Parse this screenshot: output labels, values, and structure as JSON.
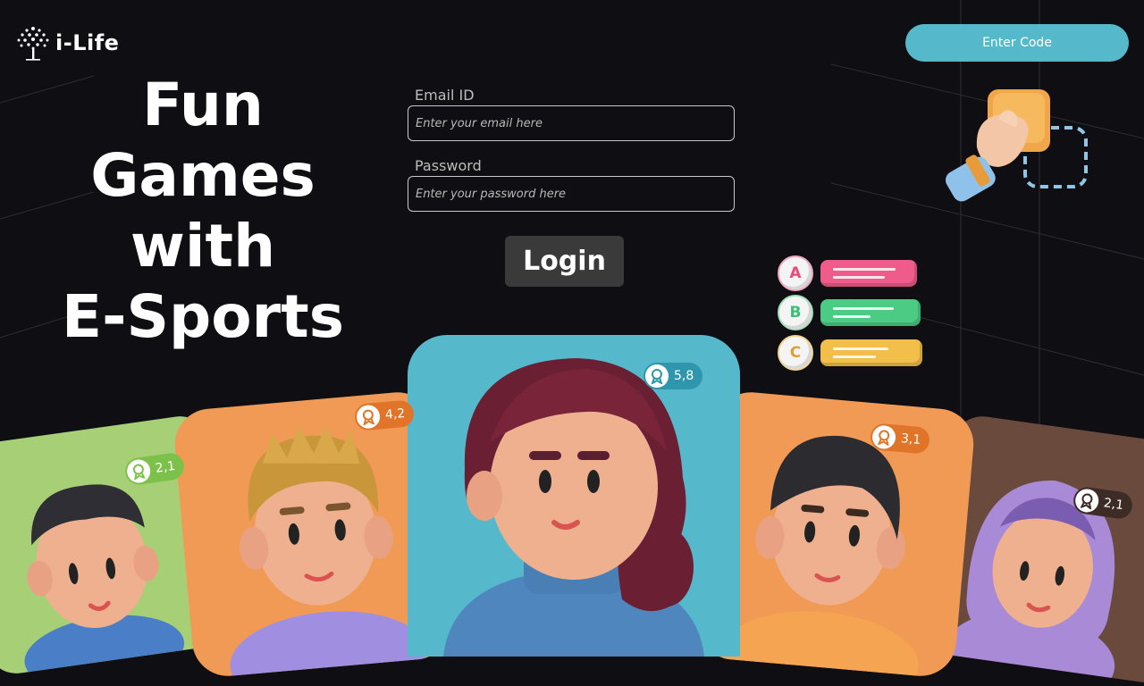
{
  "brand": {
    "name": "i-Life"
  },
  "headline": {
    "line1": "Fun",
    "line2": "Games",
    "line3": "with",
    "line4": "E-Sports"
  },
  "enter_code_label": "Enter Code",
  "form": {
    "email_label": "Email ID",
    "email_placeholder": "Enter your email here",
    "password_label": "Password",
    "password_placeholder": "Enter your password here",
    "login_label": "Login"
  },
  "quiz": {
    "options": [
      "A",
      "B",
      "C"
    ]
  },
  "players": [
    {
      "score": "2,1",
      "card_color": "#a6cf76",
      "badge_color": "#7cc24a"
    },
    {
      "score": "4,2",
      "card_color": "#f09a55",
      "badge_color": "#e0752a"
    },
    {
      "score": "5,8",
      "card_color": "#55b9cb",
      "badge_color": "#2f97ad"
    },
    {
      "score": "3,1",
      "card_color": "#f09a55",
      "badge_color": "#e0752a"
    },
    {
      "score": "2,1",
      "card_color": "#6b4a3e",
      "badge_color": "#3d2c26"
    }
  ],
  "colors": {
    "accent": "#55b9cb",
    "background": "#0f0f13"
  },
  "icons": {
    "logo": "tree-icon",
    "badge": "medal-icon",
    "hand": "hand-tap-icon"
  }
}
